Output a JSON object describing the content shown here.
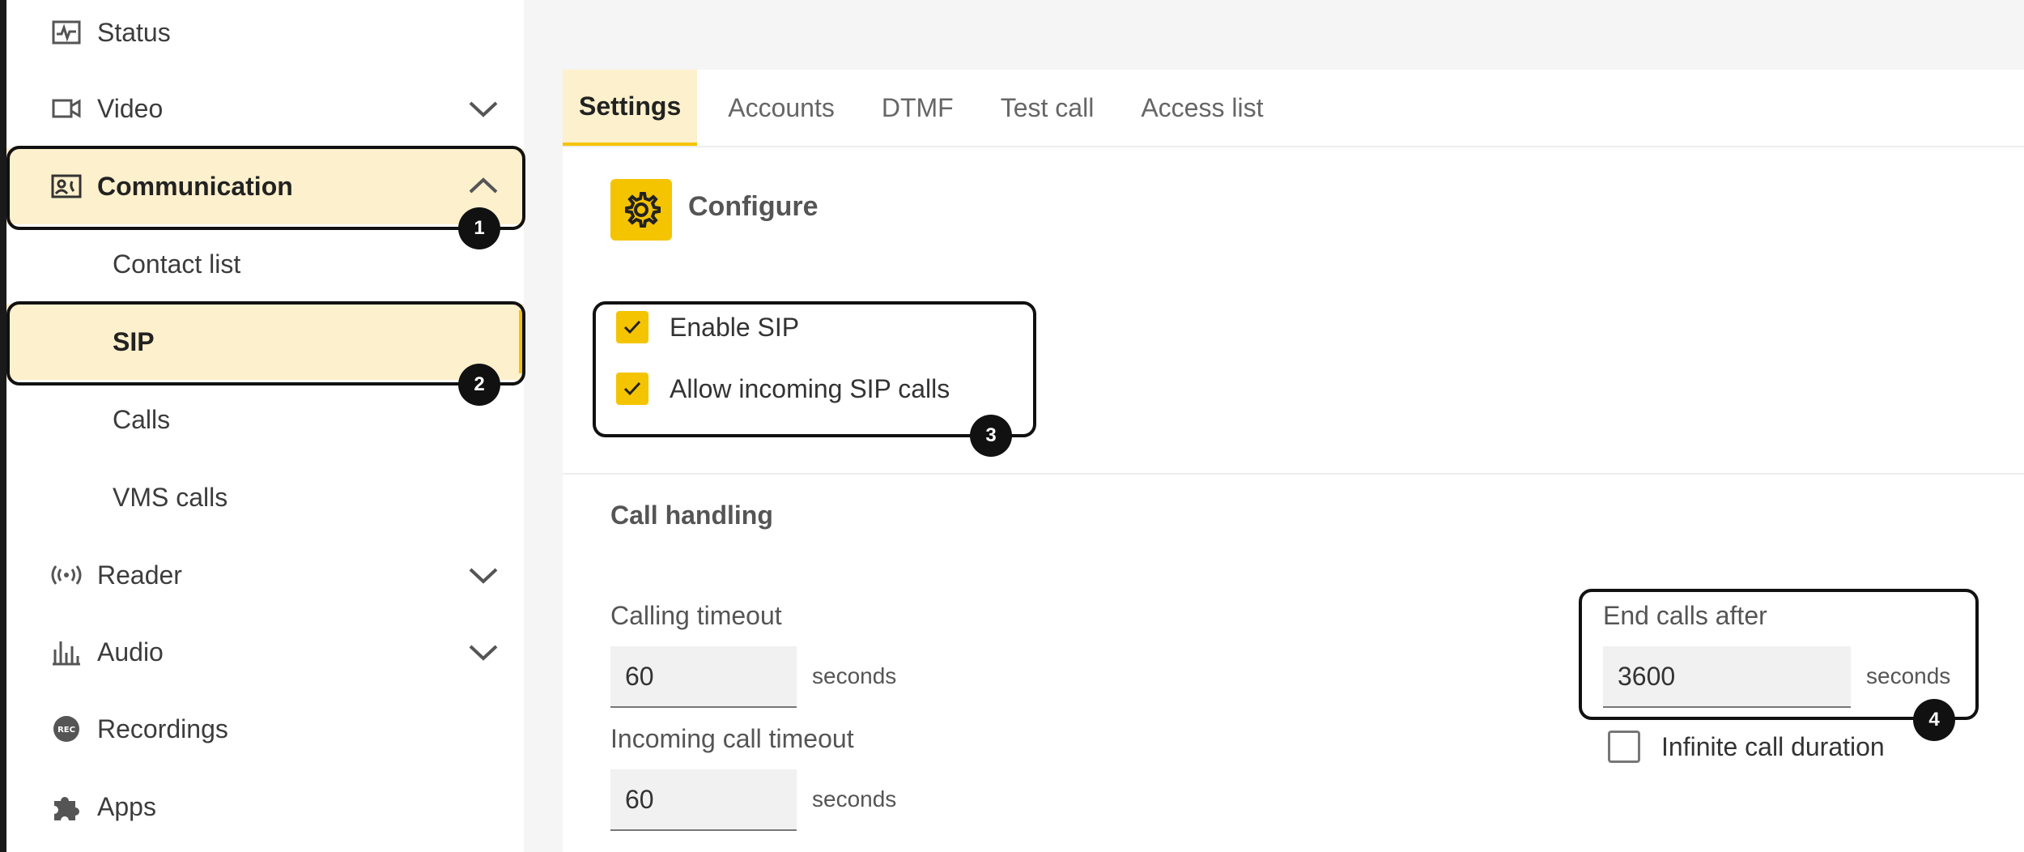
{
  "sidebar": {
    "items": [
      {
        "label": "Status",
        "icon": "status-icon"
      },
      {
        "label": "Video",
        "icon": "video-camera-icon"
      },
      {
        "label": "Communication",
        "icon": "contact-card-icon"
      },
      {
        "label": "Reader",
        "icon": "radio-signal-icon"
      },
      {
        "label": "Audio",
        "icon": "audio-levels-icon"
      },
      {
        "label": "Recordings",
        "icon": "rec-icon",
        "icon_text": "REC"
      },
      {
        "label": "Apps",
        "icon": "puzzle-icon"
      }
    ],
    "communication_subitems": [
      {
        "label": "Contact list"
      },
      {
        "label": "SIP"
      },
      {
        "label": "Calls"
      },
      {
        "label": "VMS calls"
      }
    ]
  },
  "tabs": [
    {
      "label": "Settings",
      "active": true
    },
    {
      "label": "Accounts"
    },
    {
      "label": "DTMF"
    },
    {
      "label": "Test call"
    },
    {
      "label": "Access list"
    }
  ],
  "configure": {
    "title": "Configure",
    "enable_sip": {
      "label": "Enable SIP",
      "checked": true
    },
    "allow_incoming": {
      "label": "Allow incoming SIP calls",
      "checked": true
    }
  },
  "call_handling": {
    "title": "Call handling",
    "calling_timeout": {
      "label": "Calling timeout",
      "value": "60",
      "unit": "seconds"
    },
    "incoming_call_timeout": {
      "label": "Incoming call timeout",
      "value": "60",
      "unit": "seconds"
    },
    "end_calls_after": {
      "label": "End calls after",
      "value": "3600",
      "unit": "seconds"
    },
    "infinite_call_duration": {
      "label": "Infinite call duration",
      "checked": false
    }
  },
  "callouts": [
    "1",
    "2",
    "3",
    "4"
  ],
  "colors": {
    "accent": "#f5c400",
    "highlight": "#fdf0cc",
    "callout": "#111111"
  }
}
